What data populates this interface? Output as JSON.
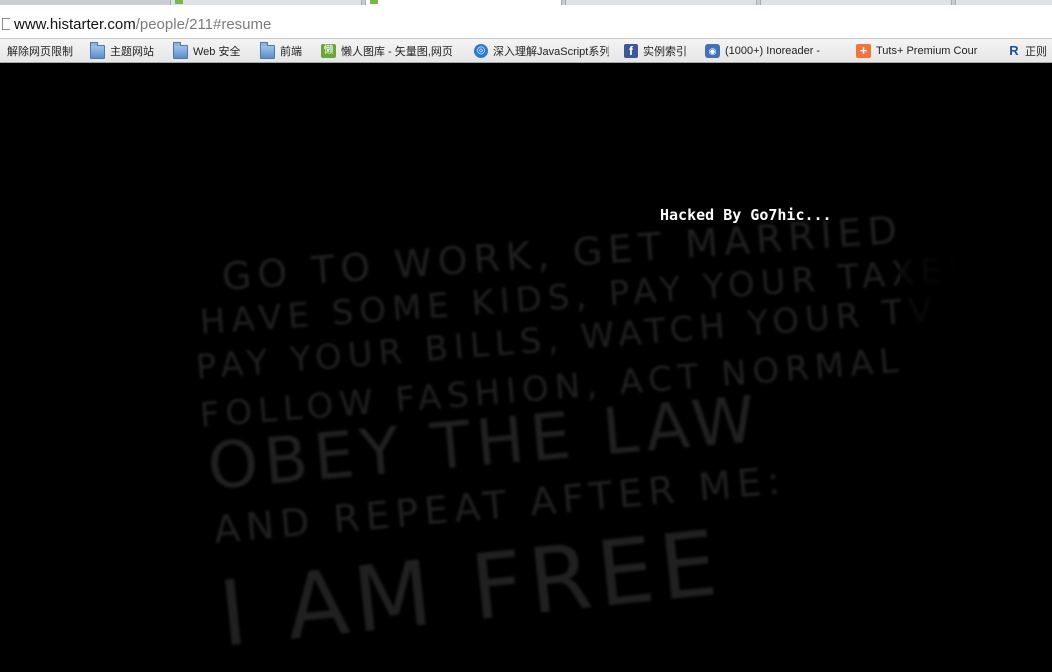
{
  "browser": {
    "url_host": "www.histarter.com",
    "url_path": "/people/211#resume"
  },
  "bookmarks": [
    {
      "label": "解除网页限制",
      "icon": "none"
    },
    {
      "label": "主题网站",
      "icon": "folder-icon"
    },
    {
      "label": "Web 安全",
      "icon": "folder-icon"
    },
    {
      "label": "前端",
      "icon": "folder-icon"
    },
    {
      "label": "懒人图库 - 矢量图,网页",
      "icon": "lanren-icon"
    },
    {
      "label": "深入理解JavaScript系列",
      "icon": "globe-icon"
    },
    {
      "label": "实例索引",
      "icon": "facebook-icon"
    },
    {
      "label": "(1000+) Inoreader -",
      "icon": "rss-icon"
    },
    {
      "label": "Tuts+ Premium Cour",
      "icon": "tuts-plus-icon"
    },
    {
      "label": "正则",
      "icon": "r-icon"
    }
  ],
  "page": {
    "hacked_text": "Hacked By Go7hic...",
    "poster_lines": [
      "GO TO WORK, GET MARRIED",
      "HAVE SOME KIDS, PAY YOUR TAXES",
      "PAY YOUR BILLS, WATCH YOUR TV",
      "FOLLOW FASHION, ACT NORMAL",
      "OBEY THE LAW",
      "AND REPEAT AFTER ME:",
      "I AM FREE"
    ]
  },
  "colors": {
    "page_background": "#000000",
    "hacked_text": "#ffffff",
    "poster_text": "#202020"
  }
}
